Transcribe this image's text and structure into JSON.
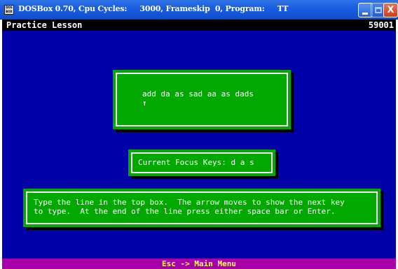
{
  "window": {
    "title": "DOSBox 0.70, Cpu Cycles:     3000, Frameskip  0, Program:     TT",
    "icon_label": "DOS BOX",
    "close_glyph": "X"
  },
  "screen": {
    "header_title": "Practice Lesson",
    "header_code": "59001",
    "lesson_line": "add da as sad aa as dads",
    "cursor_arrow": "↑",
    "focus_keys": "Current Focus Keys: d a s",
    "instructions_line1": "Type the line in the top box.  The arrow moves to show the next key",
    "instructions_line2": "to type.  At the end of the line press either space bar or Enter.",
    "footer": "Esc -> Main Menu"
  },
  "colors": {
    "screen_background": "#0000a8",
    "box_green": "#00a800",
    "footer_magenta": "#a800a8",
    "footer_text": "#ffff55",
    "titlebar_blue": "#1a5ee0"
  }
}
